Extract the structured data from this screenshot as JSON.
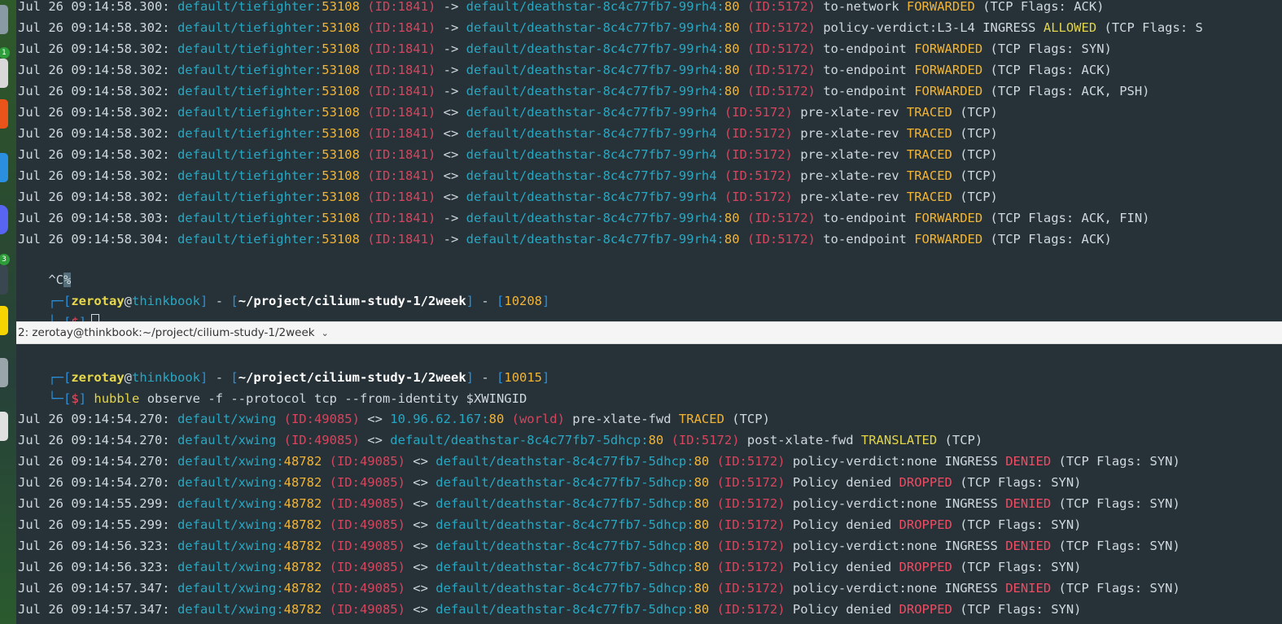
{
  "colors": {
    "background": "#263238",
    "ansi_cyan": "#28a7c2",
    "ansi_yellow": "#f2b435",
    "ansi_red": "#d6455d",
    "tab_bar": "#f5f5f5"
  },
  "dock": {
    "badges": [
      "1",
      "3"
    ]
  },
  "top_pane": {
    "log_lines": [
      [
        [
          "Jul 26 09:14:58.300: ",
          "plain"
        ],
        [
          "default/tiefighter:",
          "cyan"
        ],
        [
          "53108",
          "num"
        ],
        [
          " (ID:1841)",
          "id"
        ],
        [
          " -> ",
          "plain"
        ],
        [
          "default/deathstar-8c4c77fb7-99rh4:",
          "cyan"
        ],
        [
          "80",
          "num"
        ],
        [
          " (ID:5172)",
          "id"
        ],
        [
          " to-network ",
          "plain"
        ],
        [
          "FORWARDED",
          "fwd"
        ],
        [
          " (TCP Flags: ACK)",
          "plain"
        ]
      ],
      [
        [
          "Jul 26 09:14:58.302: ",
          "plain"
        ],
        [
          "default/tiefighter:",
          "cyan"
        ],
        [
          "53108",
          "num"
        ],
        [
          " (ID:1841)",
          "id"
        ],
        [
          " -> ",
          "plain"
        ],
        [
          "default/deathstar-8c4c77fb7-99rh4:",
          "cyan"
        ],
        [
          "80",
          "num"
        ],
        [
          " (ID:5172)",
          "id"
        ],
        [
          " policy-verdict:L3-L4 INGRESS ",
          "plain"
        ],
        [
          "ALLOWED",
          "allowed"
        ],
        [
          " (TCP Flags: S",
          "plain"
        ]
      ],
      [
        [
          "Jul 26 09:14:58.302: ",
          "plain"
        ],
        [
          "default/tiefighter:",
          "cyan"
        ],
        [
          "53108",
          "num"
        ],
        [
          " (ID:1841)",
          "id"
        ],
        [
          " -> ",
          "plain"
        ],
        [
          "default/deathstar-8c4c77fb7-99rh4:",
          "cyan"
        ],
        [
          "80",
          "num"
        ],
        [
          " (ID:5172)",
          "id"
        ],
        [
          " to-endpoint ",
          "plain"
        ],
        [
          "FORWARDED",
          "fwd"
        ],
        [
          " (TCP Flags: SYN)",
          "plain"
        ]
      ],
      [
        [
          "Jul 26 09:14:58.302: ",
          "plain"
        ],
        [
          "default/tiefighter:",
          "cyan"
        ],
        [
          "53108",
          "num"
        ],
        [
          " (ID:1841)",
          "id"
        ],
        [
          " -> ",
          "plain"
        ],
        [
          "default/deathstar-8c4c77fb7-99rh4:",
          "cyan"
        ],
        [
          "80",
          "num"
        ],
        [
          " (ID:5172)",
          "id"
        ],
        [
          " to-endpoint ",
          "plain"
        ],
        [
          "FORWARDED",
          "fwd"
        ],
        [
          " (TCP Flags: ACK)",
          "plain"
        ]
      ],
      [
        [
          "Jul 26 09:14:58.302: ",
          "plain"
        ],
        [
          "default/tiefighter:",
          "cyan"
        ],
        [
          "53108",
          "num"
        ],
        [
          " (ID:1841)",
          "id"
        ],
        [
          " -> ",
          "plain"
        ],
        [
          "default/deathstar-8c4c77fb7-99rh4:",
          "cyan"
        ],
        [
          "80",
          "num"
        ],
        [
          " (ID:5172)",
          "id"
        ],
        [
          " to-endpoint ",
          "plain"
        ],
        [
          "FORWARDED",
          "fwd"
        ],
        [
          " (TCP Flags: ACK, PSH)",
          "plain"
        ]
      ],
      [
        [
          "Jul 26 09:14:58.302: ",
          "plain"
        ],
        [
          "default/tiefighter:",
          "cyan"
        ],
        [
          "53108",
          "num"
        ],
        [
          " (ID:1841)",
          "id"
        ],
        [
          " <> ",
          "plain"
        ],
        [
          "default/deathstar-8c4c77fb7-99rh4",
          "cyan"
        ],
        [
          " (ID:5172)",
          "id"
        ],
        [
          " pre-xlate-rev ",
          "plain"
        ],
        [
          "TRACED",
          "fwd"
        ],
        [
          " (TCP)",
          "plain"
        ]
      ],
      [
        [
          "Jul 26 09:14:58.302: ",
          "plain"
        ],
        [
          "default/tiefighter:",
          "cyan"
        ],
        [
          "53108",
          "num"
        ],
        [
          " (ID:1841)",
          "id"
        ],
        [
          " <> ",
          "plain"
        ],
        [
          "default/deathstar-8c4c77fb7-99rh4",
          "cyan"
        ],
        [
          " (ID:5172)",
          "id"
        ],
        [
          " pre-xlate-rev ",
          "plain"
        ],
        [
          "TRACED",
          "fwd"
        ],
        [
          " (TCP)",
          "plain"
        ]
      ],
      [
        [
          "Jul 26 09:14:58.302: ",
          "plain"
        ],
        [
          "default/tiefighter:",
          "cyan"
        ],
        [
          "53108",
          "num"
        ],
        [
          " (ID:1841)",
          "id"
        ],
        [
          " <> ",
          "plain"
        ],
        [
          "default/deathstar-8c4c77fb7-99rh4",
          "cyan"
        ],
        [
          " (ID:5172)",
          "id"
        ],
        [
          " pre-xlate-rev ",
          "plain"
        ],
        [
          "TRACED",
          "fwd"
        ],
        [
          " (TCP)",
          "plain"
        ]
      ],
      [
        [
          "Jul 26 09:14:58.302: ",
          "plain"
        ],
        [
          "default/tiefighter:",
          "cyan"
        ],
        [
          "53108",
          "num"
        ],
        [
          " (ID:1841)",
          "id"
        ],
        [
          " <> ",
          "plain"
        ],
        [
          "default/deathstar-8c4c77fb7-99rh4",
          "cyan"
        ],
        [
          " (ID:5172)",
          "id"
        ],
        [
          " pre-xlate-rev ",
          "plain"
        ],
        [
          "TRACED",
          "fwd"
        ],
        [
          " (TCP)",
          "plain"
        ]
      ],
      [
        [
          "Jul 26 09:14:58.302: ",
          "plain"
        ],
        [
          "default/tiefighter:",
          "cyan"
        ],
        [
          "53108",
          "num"
        ],
        [
          " (ID:1841)",
          "id"
        ],
        [
          " <> ",
          "plain"
        ],
        [
          "default/deathstar-8c4c77fb7-99rh4",
          "cyan"
        ],
        [
          " (ID:5172)",
          "id"
        ],
        [
          " pre-xlate-rev ",
          "plain"
        ],
        [
          "TRACED",
          "fwd"
        ],
        [
          " (TCP)",
          "plain"
        ]
      ],
      [
        [
          "Jul 26 09:14:58.303: ",
          "plain"
        ],
        [
          "default/tiefighter:",
          "cyan"
        ],
        [
          "53108",
          "num"
        ],
        [
          " (ID:1841)",
          "id"
        ],
        [
          " -> ",
          "plain"
        ],
        [
          "default/deathstar-8c4c77fb7-99rh4:",
          "cyan"
        ],
        [
          "80",
          "num"
        ],
        [
          " (ID:5172)",
          "id"
        ],
        [
          " to-endpoint ",
          "plain"
        ],
        [
          "FORWARDED",
          "fwd"
        ],
        [
          " (TCP Flags: ACK, FIN)",
          "plain"
        ]
      ],
      [
        [
          "Jul 26 09:14:58.304: ",
          "plain"
        ],
        [
          "default/tiefighter:",
          "cyan"
        ],
        [
          "53108",
          "num"
        ],
        [
          " (ID:1841)",
          "id"
        ],
        [
          " -> ",
          "plain"
        ],
        [
          "default/deathstar-8c4c77fb7-99rh4:",
          "cyan"
        ],
        [
          "80",
          "num"
        ],
        [
          " (ID:5172)",
          "id"
        ],
        [
          " to-endpoint ",
          "plain"
        ],
        [
          "FORWARDED",
          "fwd"
        ],
        [
          " (TCP Flags: ACK)",
          "plain"
        ]
      ]
    ],
    "interrupt": {
      "text": "^C",
      "marker": "%"
    },
    "prompt": {
      "corner_top": "┌─",
      "corner_bottom": "└─",
      "user": "zerotay",
      "at": "@",
      "host": "thinkbook",
      "sep": " - ",
      "path": "~/project/cilium-study-1/2week",
      "pid": "10208",
      "dollar": "$",
      "command": ""
    }
  },
  "tab_bar": {
    "title": "2: zerotay@thinkbook:~/project/cilium-study-1/2week",
    "chevron": "⌄"
  },
  "bottom_pane": {
    "prompt": {
      "corner_top": "┌─",
      "corner_bottom": "└─",
      "user": "zerotay",
      "at": "@",
      "host": "thinkbook",
      "sep": " - ",
      "path": "~/project/cilium-study-1/2week",
      "pid": "10015",
      "dollar": "$",
      "command_name": "hubble",
      "command_args": " observe -f --protocol tcp --from-identity $XWINGID"
    },
    "log_lines": [
      [
        [
          "Jul 26 09:14:54.270: ",
          "plain"
        ],
        [
          "default/xwing",
          "cyan"
        ],
        [
          " (ID:49085)",
          "id"
        ],
        [
          " <> ",
          "plain"
        ],
        [
          "10.96.62.167:",
          "cyan"
        ],
        [
          "80",
          "num"
        ],
        [
          " (world)",
          "id"
        ],
        [
          " pre-xlate-fwd ",
          "plain"
        ],
        [
          "TRACED",
          "fwd"
        ],
        [
          " (TCP)",
          "plain"
        ]
      ],
      [
        [
          "Jul 26 09:14:54.270: ",
          "plain"
        ],
        [
          "default/xwing",
          "cyan"
        ],
        [
          " (ID:49085)",
          "id"
        ],
        [
          " <> ",
          "plain"
        ],
        [
          "default/deathstar-8c4c77fb7-5dhcp:",
          "cyan"
        ],
        [
          "80",
          "num"
        ],
        [
          " (ID:5172)",
          "id"
        ],
        [
          " post-xlate-fwd ",
          "plain"
        ],
        [
          "TRANSLATED",
          "allowed"
        ],
        [
          " (TCP)",
          "plain"
        ]
      ],
      [
        [
          "Jul 26 09:14:54.270: ",
          "plain"
        ],
        [
          "default/xwing:",
          "cyan"
        ],
        [
          "48782",
          "num"
        ],
        [
          " (ID:49085)",
          "id"
        ],
        [
          " <> ",
          "plain"
        ],
        [
          "default/deathstar-8c4c77fb7-5dhcp:",
          "cyan"
        ],
        [
          "80",
          "num"
        ],
        [
          " (ID:5172)",
          "id"
        ],
        [
          " policy-verdict:none INGRESS ",
          "plain"
        ],
        [
          "DENIED",
          "denied"
        ],
        [
          " (TCP Flags: SYN)",
          "plain"
        ]
      ],
      [
        [
          "Jul 26 09:14:54.270: ",
          "plain"
        ],
        [
          "default/xwing:",
          "cyan"
        ],
        [
          "48782",
          "num"
        ],
        [
          " (ID:49085)",
          "id"
        ],
        [
          " <> ",
          "plain"
        ],
        [
          "default/deathstar-8c4c77fb7-5dhcp:",
          "cyan"
        ],
        [
          "80",
          "num"
        ],
        [
          " (ID:5172)",
          "id"
        ],
        [
          " Policy denied ",
          "plain"
        ],
        [
          "DROPPED",
          "denied"
        ],
        [
          " (TCP Flags: SYN)",
          "plain"
        ]
      ],
      [
        [
          "Jul 26 09:14:55.299: ",
          "plain"
        ],
        [
          "default/xwing:",
          "cyan"
        ],
        [
          "48782",
          "num"
        ],
        [
          " (ID:49085)",
          "id"
        ],
        [
          " <> ",
          "plain"
        ],
        [
          "default/deathstar-8c4c77fb7-5dhcp:",
          "cyan"
        ],
        [
          "80",
          "num"
        ],
        [
          " (ID:5172)",
          "id"
        ],
        [
          " policy-verdict:none INGRESS ",
          "plain"
        ],
        [
          "DENIED",
          "denied"
        ],
        [
          " (TCP Flags: SYN)",
          "plain"
        ]
      ],
      [
        [
          "Jul 26 09:14:55.299: ",
          "plain"
        ],
        [
          "default/xwing:",
          "cyan"
        ],
        [
          "48782",
          "num"
        ],
        [
          " (ID:49085)",
          "id"
        ],
        [
          " <> ",
          "plain"
        ],
        [
          "default/deathstar-8c4c77fb7-5dhcp:",
          "cyan"
        ],
        [
          "80",
          "num"
        ],
        [
          " (ID:5172)",
          "id"
        ],
        [
          " Policy denied ",
          "plain"
        ],
        [
          "DROPPED",
          "denied"
        ],
        [
          " (TCP Flags: SYN)",
          "plain"
        ]
      ],
      [
        [
          "Jul 26 09:14:56.323: ",
          "plain"
        ],
        [
          "default/xwing:",
          "cyan"
        ],
        [
          "48782",
          "num"
        ],
        [
          " (ID:49085)",
          "id"
        ],
        [
          " <> ",
          "plain"
        ],
        [
          "default/deathstar-8c4c77fb7-5dhcp:",
          "cyan"
        ],
        [
          "80",
          "num"
        ],
        [
          " (ID:5172)",
          "id"
        ],
        [
          " policy-verdict:none INGRESS ",
          "plain"
        ],
        [
          "DENIED",
          "denied"
        ],
        [
          " (TCP Flags: SYN)",
          "plain"
        ]
      ],
      [
        [
          "Jul 26 09:14:56.323: ",
          "plain"
        ],
        [
          "default/xwing:",
          "cyan"
        ],
        [
          "48782",
          "num"
        ],
        [
          " (ID:49085)",
          "id"
        ],
        [
          " <> ",
          "plain"
        ],
        [
          "default/deathstar-8c4c77fb7-5dhcp:",
          "cyan"
        ],
        [
          "80",
          "num"
        ],
        [
          " (ID:5172)",
          "id"
        ],
        [
          " Policy denied ",
          "plain"
        ],
        [
          "DROPPED",
          "denied"
        ],
        [
          " (TCP Flags: SYN)",
          "plain"
        ]
      ],
      [
        [
          "Jul 26 09:14:57.347: ",
          "plain"
        ],
        [
          "default/xwing:",
          "cyan"
        ],
        [
          "48782",
          "num"
        ],
        [
          " (ID:49085)",
          "id"
        ],
        [
          " <> ",
          "plain"
        ],
        [
          "default/deathstar-8c4c77fb7-5dhcp:",
          "cyan"
        ],
        [
          "80",
          "num"
        ],
        [
          " (ID:5172)",
          "id"
        ],
        [
          " policy-verdict:none INGRESS ",
          "plain"
        ],
        [
          "DENIED",
          "denied"
        ],
        [
          " (TCP Flags: SYN)",
          "plain"
        ]
      ],
      [
        [
          "Jul 26 09:14:57.347: ",
          "plain"
        ],
        [
          "default/xwing:",
          "cyan"
        ],
        [
          "48782",
          "num"
        ],
        [
          " (ID:49085)",
          "id"
        ],
        [
          " <> ",
          "plain"
        ],
        [
          "default/deathstar-8c4c77fb7-5dhcp:",
          "cyan"
        ],
        [
          "80",
          "num"
        ],
        [
          " (ID:5172)",
          "id"
        ],
        [
          " Policy denied ",
          "plain"
        ],
        [
          "DROPPED",
          "denied"
        ],
        [
          " (TCP Flags: SYN)",
          "plain"
        ]
      ]
    ]
  }
}
